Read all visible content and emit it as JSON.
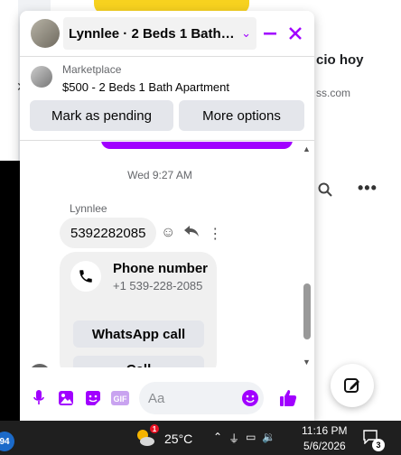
{
  "background": {
    "snippet_title": "cio hoy",
    "snippet_domain": "ss.com"
  },
  "chat": {
    "title": "Lynnlee · 2 Beds 1 Bath Ap...",
    "header_icons": [
      "chevron-down-icon",
      "minimize-icon",
      "close-icon"
    ],
    "accent_color": "#a100ff",
    "listing": {
      "source": "Marketplace",
      "title": "$500 - 2 Beds 1 Bath Apartment",
      "btn_pending": "Mark as pending",
      "btn_more": "More options"
    },
    "time_separator": "Wed 9:27 AM",
    "sender_name": "Lynnlee",
    "message_text": "5392282085",
    "phone_card": {
      "title": "Phone number",
      "number": "+1 539-228-2085",
      "whatsapp_btn": "WhatsApp call",
      "call_btn": "Call"
    },
    "composer": {
      "placeholder": "Aa",
      "icons": [
        "microphone-icon",
        "photo-icon",
        "sticker-icon",
        "gif-icon",
        "emoji-icon",
        "thumbs-up-icon"
      ]
    }
  },
  "taskbar": {
    "temperature": "25°C",
    "weather_badge": "1",
    "time": "11:16 PM",
    "date": "5/6/2026",
    "notification_count": "3",
    "corner_badge": "94"
  }
}
